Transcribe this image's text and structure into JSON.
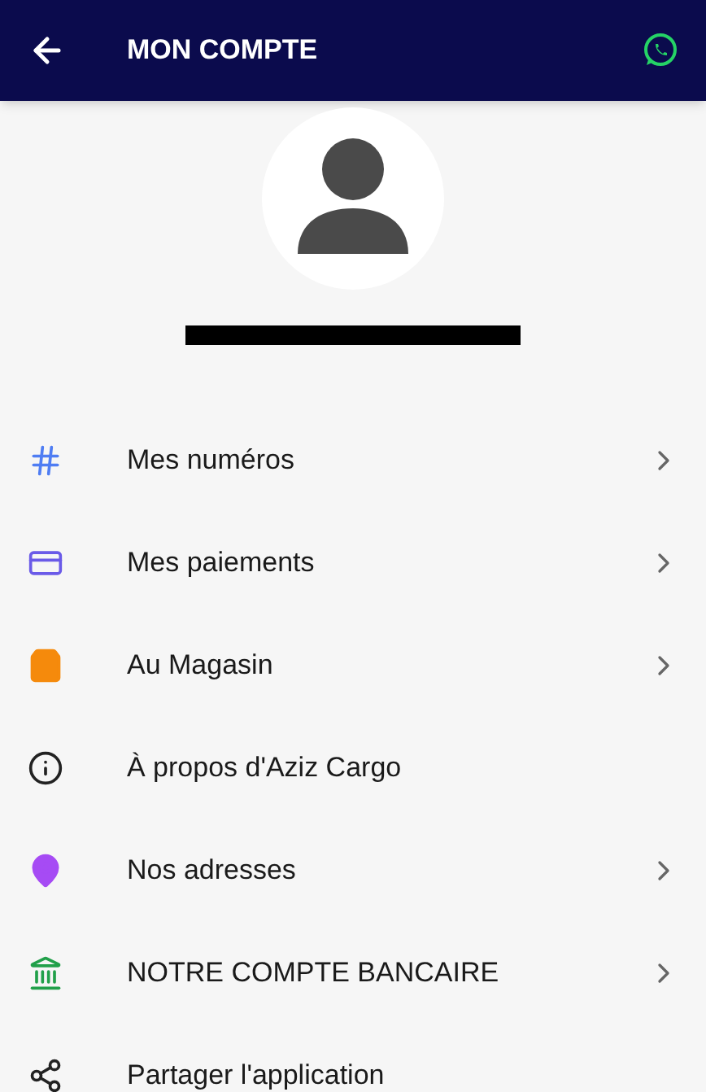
{
  "header": {
    "title": "MON COMPTE"
  },
  "menu": [
    {
      "kind": "hash",
      "label": "Mes numéros",
      "chevron": true,
      "color": "#4f7df3"
    },
    {
      "kind": "card",
      "label": "Mes paiements",
      "chevron": true,
      "color": "#6a5ae8"
    },
    {
      "kind": "bag",
      "label": "Au Magasin",
      "chevron": true,
      "color": "#f58a0c"
    },
    {
      "kind": "info",
      "label": "À propos d'Aziz Cargo",
      "chevron": false,
      "color": "#222222"
    },
    {
      "kind": "pin",
      "label": "Nos adresses",
      "chevron": true,
      "color": "#a64bf4"
    },
    {
      "kind": "bank",
      "label": "NOTRE COMPTE BANCAIRE",
      "chevron": true,
      "color": "#21a04a"
    },
    {
      "kind": "share",
      "label": "Partager l'application",
      "chevron": false,
      "color": "#222222"
    }
  ]
}
